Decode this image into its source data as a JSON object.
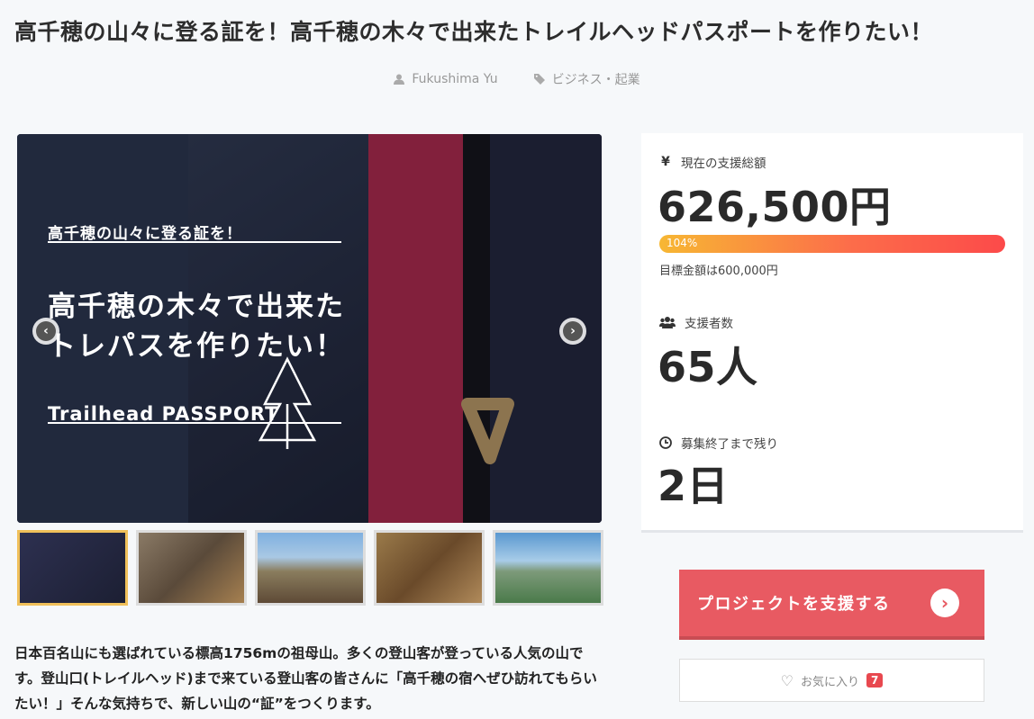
{
  "project": {
    "title": "高千穂の山々に登る証を！高千穂の木々で出来たトレイルヘッドパスポートを作りたい！",
    "author": "Fukushima Yu",
    "category": "ビジネス・起業"
  },
  "hero": {
    "overlay_sub": "高千穂の山々に登る証を！",
    "overlay_main_line1": "高千穂の木々で出来た",
    "overlay_main_line2": "トレパスを作りたい！",
    "overlay_brand": "Trailhead PASSPORT",
    "prev_icon": "‹",
    "next_icon": "›"
  },
  "thumbnails": [
    {
      "name": "thumb-1",
      "active": true,
      "color": "#2d3050"
    },
    {
      "name": "thumb-2",
      "active": false,
      "color": "#6b5a4a"
    },
    {
      "name": "thumb-3",
      "active": false,
      "color": "#8a7d5e"
    },
    {
      "name": "thumb-4",
      "active": false,
      "color": "#7a5a3a"
    },
    {
      "name": "thumb-5",
      "active": false,
      "color": "#6fa0c8"
    }
  ],
  "description": "日本百名山にも選ばれている標高1756mの祖母山。多くの登山客が登っている人気の山です。登山口(トレイルヘッド)まで来ている登山客の皆さんに「高千穂の宿へぜひ訪れてもらいたい！」そんな気持ちで、新しい山の“証”をつくります。",
  "stats": {
    "total_label": "現在の支援総額",
    "total_icon": "¥",
    "total_value": "626,500円",
    "progress_percent": 104,
    "progress_label": "104%",
    "goal_text": "目標金額は600,000円",
    "backers_label": "支援者数",
    "backers_value": "65人",
    "remaining_label": "募集終了まで残り",
    "remaining_value": "2日"
  },
  "actions": {
    "support_label": "プロジェクトを支援する",
    "favorite_label": "お気に入り",
    "favorite_count": "7"
  },
  "colors": {
    "accent": "#e85a62",
    "progress_start": "#f7b733",
    "progress_end": "#fc4a4a"
  }
}
